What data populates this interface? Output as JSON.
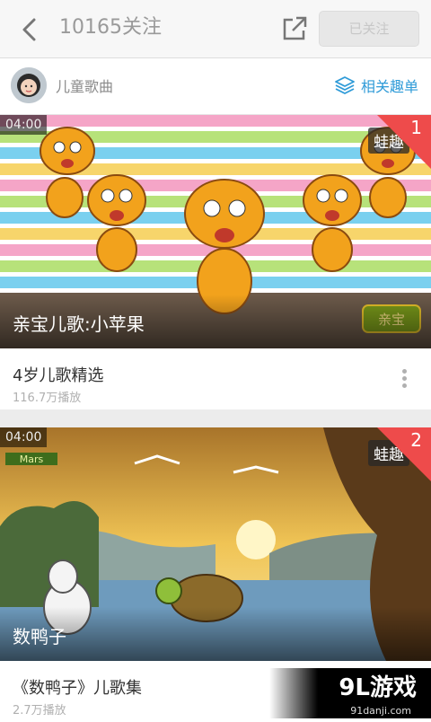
{
  "header": {
    "title": "10165关注",
    "follow_label": "已关注"
  },
  "channel": {
    "name": "儿童歌曲",
    "related_label": "相关趣单"
  },
  "videos": [
    {
      "duration": "04:00",
      "rank": "1",
      "watermark": "蛙趣",
      "caption": "亲宝儿歌:小苹果",
      "thumb_logo": "亲宝",
      "title": "4岁儿歌精选",
      "plays": "116.7万播放"
    },
    {
      "duration": "04:00",
      "rank": "2",
      "watermark": "蛙趣",
      "thumb_logo": "Mars",
      "caption": "数鸭子",
      "title": "《数鸭子》儿歌集",
      "plays": "2.7万播放"
    }
  ],
  "site_watermark": {
    "logo": "9L游戏",
    "url": "91danji.com"
  },
  "colors": {
    "accent": "#2f9bd8",
    "rank_badge": "#ee4b4b"
  }
}
